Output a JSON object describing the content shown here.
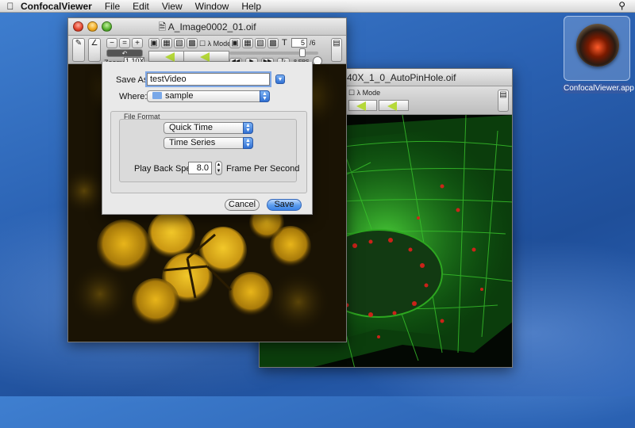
{
  "menubar": {
    "app_name": "ConfocalViewer",
    "menus": [
      "File",
      "Edit",
      "View",
      "Window",
      "Help"
    ]
  },
  "desktop_icon": {
    "label": "ConfocalViewer.app"
  },
  "window_main": {
    "title": "A_Image0002_01.oif",
    "zoom_label": "Zoom:",
    "zoom_value": "1.10X",
    "lambda_mode": "λ Mode",
    "t_label": "T",
    "frame_value": "5",
    "frame_total": "/6",
    "fps_label": "FPS",
    "zoom_minus": "−",
    "zoom_equal": "=",
    "zoom_plus": "+"
  },
  "window_second": {
    "title": "40X_1_0_AutoPinHole.oif",
    "lambda_mode": "λ Mode"
  },
  "save_sheet": {
    "save_as_label": "Save As:",
    "save_as_value": "testVideo",
    "where_label": "Where:",
    "where_value": "sample",
    "file_format_title": "File Format",
    "format_value": "Quick Time",
    "type_value": "Time Series",
    "speed_label": "Play Back Speed:",
    "speed_value": "8.0",
    "speed_unit": "Frame Per Second",
    "cancel_label": "Cancel",
    "save_label": "Save"
  }
}
